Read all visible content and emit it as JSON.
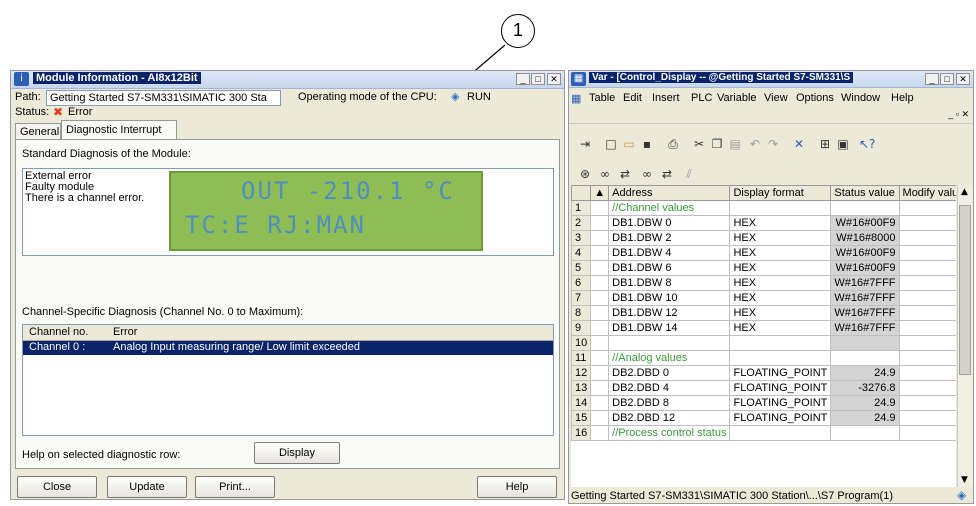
{
  "callout": {
    "number": "1"
  },
  "module_info": {
    "title": "Module Information - AI8x12Bit",
    "path_label": "Path:",
    "path_value": "Getting Started S7-SM331\\SIMATIC 300 Sta",
    "cpu_mode_label": "Operating mode of the CPU:",
    "cpu_mode_value": "RUN",
    "status_label": "Status:",
    "status_value": "Error",
    "tabs": [
      "General",
      "Diagnostic Interrupt"
    ],
    "standard_diag_label": "Standard Diagnosis of the Module:",
    "standard_diag_items": [
      "External error",
      "Faulty module",
      "There is a channel error."
    ],
    "lcd": {
      "line1": "OUT -210.1 °C",
      "line2": "TC:E  RJ:MAN"
    },
    "channel_diag_label": "Channel-Specific Diagnosis (Channel No. 0 to Maximum):",
    "channel_columns": [
      "Channel no.",
      "Error"
    ],
    "channel_rows": [
      {
        "channel": "Channel 0 :",
        "error": "Analog Input measuring range/ Low limit exceeded"
      }
    ],
    "help_label": "Help on selected diagnostic row:",
    "display_button": "Display",
    "buttons": {
      "close": "Close",
      "update": "Update",
      "print": "Print...",
      "help": "Help"
    }
  },
  "var_table": {
    "title": "Var - [Control_Display -- @Getting Started S7-SM331\\S",
    "menu": [
      "Table",
      "Edit",
      "Insert",
      "PLC",
      "Variable",
      "View",
      "Options",
      "Window",
      "Help"
    ],
    "columns": [
      "Address",
      "Display format",
      "Status value",
      "Modify value"
    ],
    "rows": [
      {
        "n": "1",
        "address": "//Channel values",
        "format": "",
        "status": "",
        "comment": true
      },
      {
        "n": "2",
        "address": "DB1.DBW   0",
        "format": "HEX",
        "status": "W#16#00F9",
        "comment": false
      },
      {
        "n": "3",
        "address": "DB1.DBW   2",
        "format": "HEX",
        "status": "W#16#8000",
        "comment": false
      },
      {
        "n": "4",
        "address": "DB1.DBW   4",
        "format": "HEX",
        "status": "W#16#00F9",
        "comment": false
      },
      {
        "n": "5",
        "address": "DB1.DBW   6",
        "format": "HEX",
        "status": "W#16#00F9",
        "comment": false
      },
      {
        "n": "6",
        "address": "DB1.DBW   8",
        "format": "HEX",
        "status": "W#16#7FFF",
        "comment": false
      },
      {
        "n": "7",
        "address": "DB1.DBW  10",
        "format": "HEX",
        "status": "W#16#7FFF",
        "comment": false
      },
      {
        "n": "8",
        "address": "DB1.DBW  12",
        "format": "HEX",
        "status": "W#16#7FFF",
        "comment": false
      },
      {
        "n": "9",
        "address": "DB1.DBW  14",
        "format": "HEX",
        "status": "W#16#7FFF",
        "comment": false
      },
      {
        "n": "10",
        "address": "",
        "format": "",
        "status": "",
        "comment": false
      },
      {
        "n": "11",
        "address": "//Analog values",
        "format": "",
        "status": "",
        "comment": true
      },
      {
        "n": "12",
        "address": "DB2.DBD   0",
        "format": "FLOATING_POINT",
        "status": "24.9",
        "comment": false
      },
      {
        "n": "13",
        "address": "DB2.DBD   4",
        "format": "FLOATING_POINT",
        "status": "-3276.8",
        "comment": false
      },
      {
        "n": "14",
        "address": "DB2.DBD   8",
        "format": "FLOATING_POINT",
        "status": "24.9",
        "comment": false
      },
      {
        "n": "15",
        "address": "DB2.DBD  12",
        "format": "FLOATING_POINT",
        "status": "24.9",
        "comment": false
      },
      {
        "n": "16",
        "address": "//Process control status",
        "format": "",
        "status": "",
        "comment": true
      }
    ],
    "status_bar": "Getting Started S7-SM331\\SIMATIC 300 Station\\...\\S7 Program(1)"
  }
}
